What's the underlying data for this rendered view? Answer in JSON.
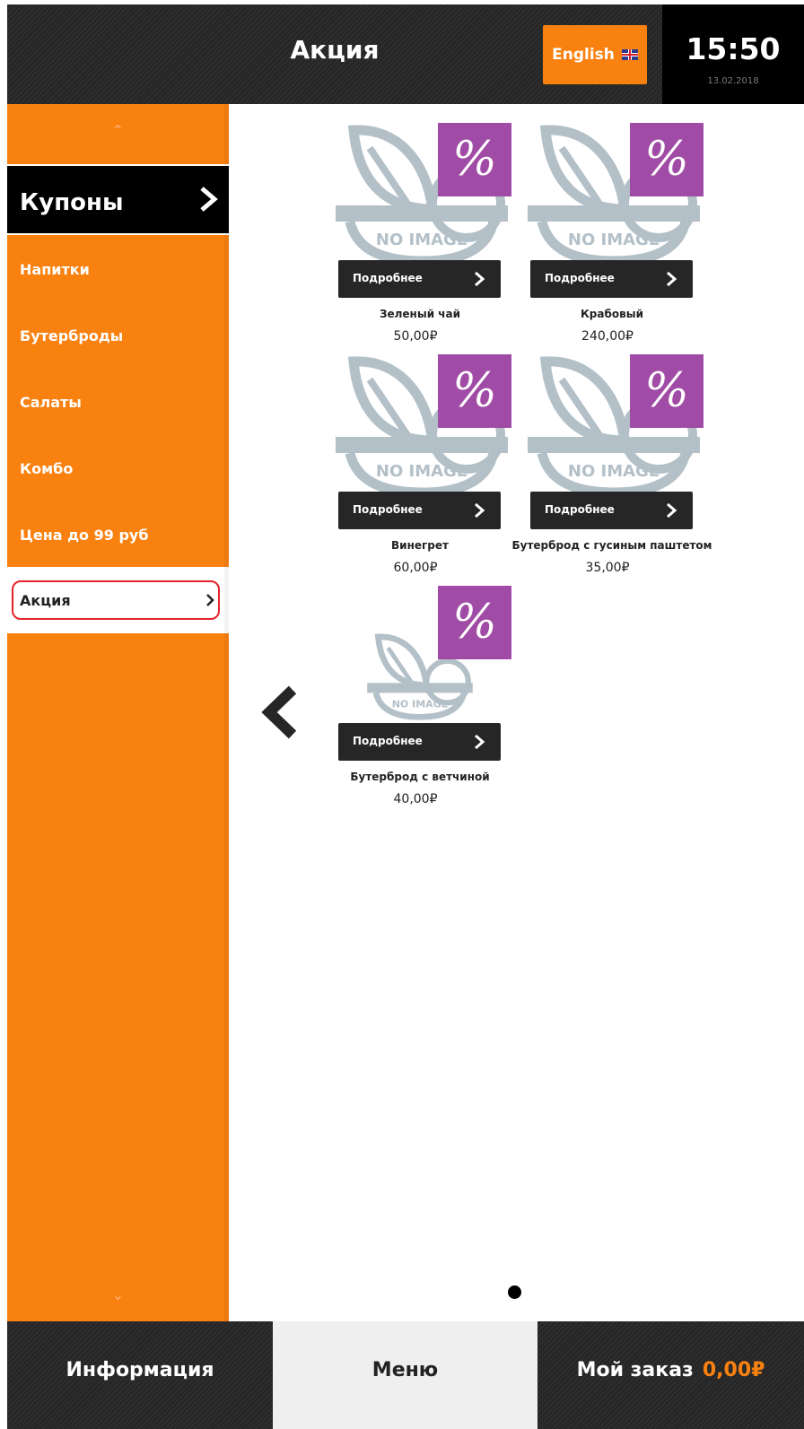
{
  "header": {
    "title": "Акция",
    "language_label": "English",
    "time": "15:50",
    "date": "13.02.2018"
  },
  "sidebar": {
    "featured": "Купоны",
    "categories": [
      {
        "label": "Напитки"
      },
      {
        "label": "Бутерброды"
      },
      {
        "label": "Салаты"
      },
      {
        "label": "Комбо"
      },
      {
        "label": "Цена до 99 руб"
      },
      {
        "label": "Акция"
      }
    ],
    "active_index": 5
  },
  "products": [
    {
      "name": "Зеленый чай",
      "price": "50,00₽",
      "badge": "%",
      "details_label": "Подробнее",
      "image_text": "NO IMAGE"
    },
    {
      "name": "Крабовый",
      "price": "240,00₽",
      "badge": "%",
      "details_label": "Подробнее",
      "image_text": "NO IMAGE"
    },
    {
      "name": "Винегрет",
      "price": "60,00₽",
      "badge": "%",
      "details_label": "Подробнее",
      "image_text": "NO IMAGE"
    },
    {
      "name": "Бутерброд с гусиным паштетом",
      "price": "35,00₽",
      "badge": "%",
      "details_label": "Подробнее",
      "image_text": "NO IMAGE"
    },
    {
      "name": "Бутерброд с ветчиной",
      "price": "40,00₽",
      "badge": "%",
      "details_label": "Подробнее",
      "image_text": "NO IMAGE"
    }
  ],
  "pagination": {
    "current_page": 1,
    "page_count": 1
  },
  "bottom": {
    "info_label": "Информация",
    "menu_label": "Меню",
    "order_label": "Мой заказ",
    "order_total": "0,00₽"
  },
  "colors": {
    "accent": "#f98110",
    "dark": "#262626",
    "promo": "#a04ba6",
    "active_outline": "#e3242b",
    "placeholder": "#b3c0c8"
  }
}
